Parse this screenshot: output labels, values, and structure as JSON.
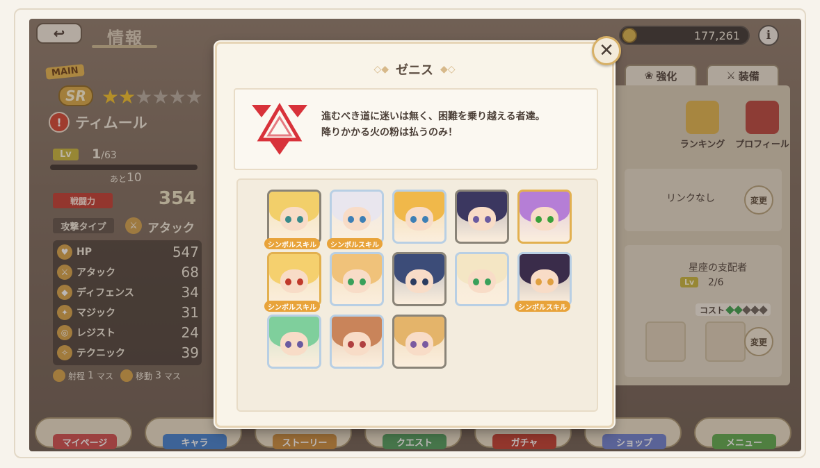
{
  "header": {
    "back_icon": "↩",
    "title": "情報",
    "gold": "177,261",
    "info_label": "i"
  },
  "character": {
    "main_tag": "MAIN",
    "rarity": "SR",
    "stars_filled": 2,
    "stars_total": 6,
    "name": "ティムール",
    "lv_label": "Lv",
    "lv_value": "1",
    "lv_max": "/63",
    "exp_fraction": 0.0,
    "next_label": "あと",
    "next_value": "10",
    "power_label": "戦闘力",
    "power_value": "354",
    "attack_type_label": "攻撃タイプ",
    "attack_type_value": "アタック",
    "stats": [
      {
        "name": "HP",
        "value": "547"
      },
      {
        "name": "アタック",
        "value": "68"
      },
      {
        "name": "ディフェンス",
        "value": "34"
      },
      {
        "name": "マジック",
        "value": "31"
      },
      {
        "name": "レジスト",
        "value": "24"
      },
      {
        "name": "テクニック",
        "value": "39"
      }
    ],
    "range_label": "射程",
    "range_value": "1",
    "move_label": "移動",
    "move_value": "3",
    "unit": "マス"
  },
  "right_panel": {
    "tabs": [
      {
        "label": "強化",
        "icon": "paw-icon"
      },
      {
        "label": "装備",
        "icon": "sword-icon"
      }
    ],
    "ranking_label": "ランキング",
    "profile_label": "プロフィール",
    "link_text": "リンクなし",
    "change_label": "変更",
    "constellation": "星座の支配者",
    "constellation_lv_label": "Lv",
    "constellation_lv": "2/6",
    "cost_label": "コスト",
    "cost_filled": 2,
    "cost_total": 5
  },
  "modal": {
    "title": "ゼニス",
    "motto_line1": "進むべき道に迷いは無く、困難を乗り越える者達。",
    "motto_line2": "降りかかる火の粉は払うのみ！",
    "close_icon": "✕",
    "symbol_skill_label": "シンボルスキル",
    "members": [
      {
        "hair": "#f2cf6a",
        "eye": "#3a8a8a",
        "frame": "dark",
        "symbol": true
      },
      {
        "hair": "#e9e6ee",
        "eye": "#3d7fb5",
        "frame": "blue",
        "symbol": true
      },
      {
        "hair": "#f0b84a",
        "eye": "#3d7fb5",
        "frame": "blue",
        "symbol": false
      },
      {
        "hair": "#3b3760",
        "eye": "#6a5aa0",
        "frame": "dark",
        "symbol": false
      },
      {
        "hair": "#b57ed6",
        "eye": "#3aa03a",
        "frame": "gold",
        "symbol": false
      },
      {
        "hair": "#f5d06e",
        "eye": "#c0392b",
        "frame": "gold",
        "symbol": true
      },
      {
        "hair": "#f0c27a",
        "eye": "#3aa05a",
        "frame": "blue",
        "symbol": false
      },
      {
        "hair": "#3c4c78",
        "eye": "#2b3c60",
        "frame": "dark",
        "symbol": false
      },
      {
        "hair": "#f4e6c4",
        "eye": "#3aa05a",
        "frame": "blue",
        "symbol": false
      },
      {
        "hair": "#3a2c4a",
        "eye": "#e0a040",
        "frame": "blue",
        "symbol": true
      },
      {
        "hair": "#7fcf9c",
        "eye": "#6a5aa0",
        "frame": "blue",
        "symbol": false
      },
      {
        "hair": "#c9845a",
        "eye": "#b04040",
        "frame": "blue",
        "symbol": false
      },
      {
        "hair": "#e4b46a",
        "eye": "#7a5aa0",
        "frame": "dark",
        "symbol": false
      }
    ]
  },
  "bottom_nav": [
    {
      "label": "マイページ",
      "color": "#d04a4a"
    },
    {
      "label": "キャラ",
      "color": "#3e7fcf"
    },
    {
      "label": "ストーリー",
      "color": "#c98a3a"
    },
    {
      "label": "クエスト",
      "color": "#4c9a5a"
    },
    {
      "label": "ガチャ",
      "color": "#c0392b"
    },
    {
      "label": "ショップ",
      "color": "#6a7fd0"
    },
    {
      "label": "メニュー",
      "color": "#5aaa4a"
    }
  ],
  "colors": {
    "accent_gold": "#e2b04f",
    "emblem_red": "#d8323a"
  }
}
